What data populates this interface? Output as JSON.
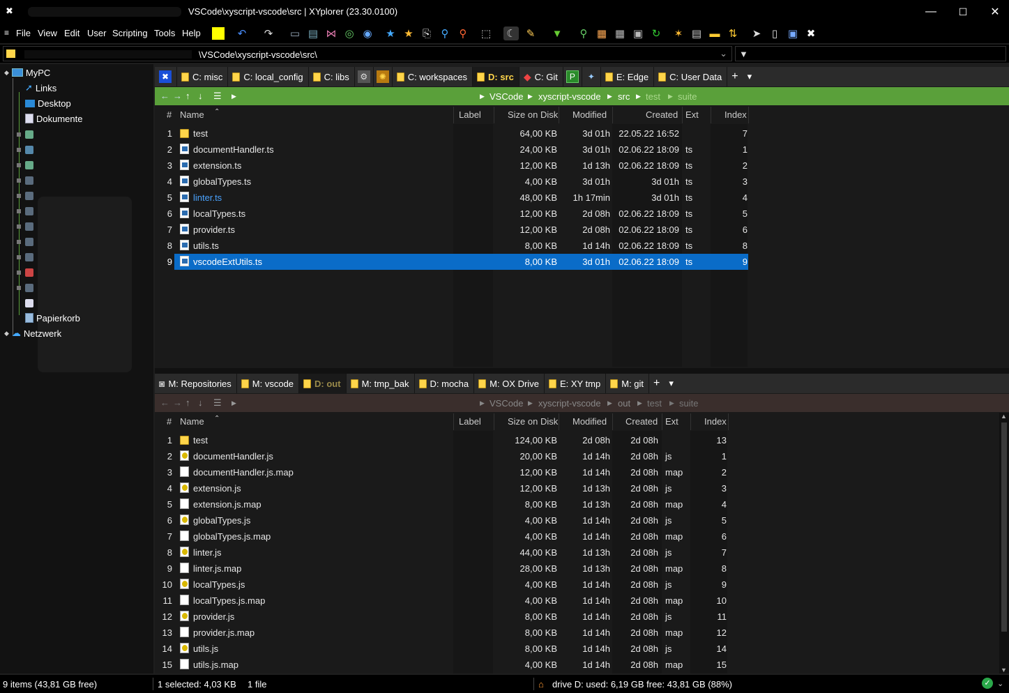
{
  "window": {
    "title": "VSCode\\xyscript-vscode\\src | XYplorer (23.30.0100)",
    "min": "—",
    "max": "☐",
    "close": "✕"
  },
  "menu": [
    "File",
    "View",
    "Edit",
    "User",
    "Scripting",
    "Tools",
    "Help"
  ],
  "address": {
    "value": "\\VSCode\\xyscript-vscode\\src\\"
  },
  "tree": {
    "root": "MyPC",
    "items": [
      "Links",
      "Desktop",
      "Dokumente"
    ],
    "recycle": "Papierkorb",
    "network": "Netzwerk"
  },
  "top_pane": {
    "tabs": [
      {
        "label": "",
        "icon": "xy-icon"
      },
      {
        "label": "C: misc"
      },
      {
        "label": "C: local_config"
      },
      {
        "label": "C: libs"
      },
      {
        "label": "",
        "icon": "gear-icon"
      },
      {
        "label": "",
        "icon": "sun-icon"
      },
      {
        "label": "C: workspaces"
      },
      {
        "label": "D: src",
        "active": true
      },
      {
        "label": "C: Git",
        "icon": "git-icon"
      },
      {
        "label": "",
        "icon": "p-icon"
      },
      {
        "label": "",
        "icon": "tool-icon"
      },
      {
        "label": "E: Edge"
      },
      {
        "label": "C: User Data"
      }
    ],
    "add_tab": "+",
    "tab_menu": "▾",
    "breadcrumb": [
      "VSCode",
      "xyscript-vscode",
      "src",
      "test",
      "suite"
    ],
    "columns": {
      "num": "#",
      "name": "Name",
      "label": "Label",
      "size": "Size on Disk",
      "modified": "Modified",
      "created": "Created",
      "ext": "Ext",
      "index": "Index"
    },
    "rows": [
      {
        "n": "1",
        "name": "test",
        "type": "folder",
        "size": "64,00 KB",
        "modified": "3d 01h",
        "created": "22.05.22  16:52",
        "ext": "",
        "index": "7"
      },
      {
        "n": "2",
        "name": "documentHandler.ts",
        "type": "ts",
        "size": "24,00 KB",
        "modified": "3d 01h",
        "created": "02.06.22  18:09",
        "ext": "ts",
        "index": "1"
      },
      {
        "n": "3",
        "name": "extension.ts",
        "type": "ts",
        "size": "12,00 KB",
        "modified": "1d 13h",
        "created": "02.06.22  18:09",
        "ext": "ts",
        "index": "2"
      },
      {
        "n": "4",
        "name": "globalTypes.ts",
        "type": "ts",
        "size": "4,00 KB",
        "modified": "3d 01h",
        "created": "3d 01h",
        "ext": "ts",
        "index": "3"
      },
      {
        "n": "5",
        "name": "linter.ts",
        "type": "ts",
        "size": "48,00 KB",
        "modified": "1h 17min",
        "created": "3d 01h",
        "ext": "ts",
        "index": "4",
        "highlight": true
      },
      {
        "n": "6",
        "name": "localTypes.ts",
        "type": "ts",
        "size": "12,00 KB",
        "modified": "2d 08h",
        "created": "02.06.22  18:09",
        "ext": "ts",
        "index": "5"
      },
      {
        "n": "7",
        "name": "provider.ts",
        "type": "ts",
        "size": "12,00 KB",
        "modified": "2d 08h",
        "created": "02.06.22  18:09",
        "ext": "ts",
        "index": "6"
      },
      {
        "n": "8",
        "name": "utils.ts",
        "type": "ts",
        "size": "8,00 KB",
        "modified": "1d 14h",
        "created": "02.06.22  18:09",
        "ext": "ts",
        "index": "8"
      },
      {
        "n": "9",
        "name": "vscodeExtUtils.ts",
        "type": "ts",
        "size": "8,00 KB",
        "modified": "3d 01h",
        "created": "02.06.22  18:09",
        "ext": "ts",
        "index": "9",
        "selected": true
      }
    ]
  },
  "bottom_pane": {
    "tabs": [
      {
        "label": "M: Repositories",
        "icon": "camera-icon"
      },
      {
        "label": "M: vscode"
      },
      {
        "label": "D: out",
        "active": true
      },
      {
        "label": "M: tmp_bak"
      },
      {
        "label": "D: mocha"
      },
      {
        "label": "M: OX Drive"
      },
      {
        "label": "E: XY tmp"
      },
      {
        "label": "M: git"
      }
    ],
    "add_tab": "+",
    "tab_menu": "▾",
    "breadcrumb": [
      "VSCode",
      "xyscript-vscode",
      "out",
      "test",
      "suite"
    ],
    "columns": {
      "num": "#",
      "name": "Name",
      "label": "Label",
      "size": "Size on Disk",
      "modified": "Modified",
      "created": "Created",
      "ext": "Ext",
      "index": "Index"
    },
    "rows": [
      {
        "n": "1",
        "name": "test",
        "type": "folder",
        "size": "124,00 KB",
        "modified": "2d 08h",
        "created": "2d 08h",
        "ext": "",
        "index": "13"
      },
      {
        "n": "2",
        "name": "documentHandler.js",
        "type": "js",
        "size": "20,00 KB",
        "modified": "1d 14h",
        "created": "2d 08h",
        "ext": "js",
        "index": "1"
      },
      {
        "n": "3",
        "name": "documentHandler.js.map",
        "type": "map",
        "size": "12,00 KB",
        "modified": "1d 14h",
        "created": "2d 08h",
        "ext": "map",
        "index": "2"
      },
      {
        "n": "4",
        "name": "extension.js",
        "type": "js",
        "size": "12,00 KB",
        "modified": "1d 13h",
        "created": "2d 08h",
        "ext": "js",
        "index": "3"
      },
      {
        "n": "5",
        "name": "extension.js.map",
        "type": "map",
        "size": "8,00 KB",
        "modified": "1d 13h",
        "created": "2d 08h",
        "ext": "map",
        "index": "4"
      },
      {
        "n": "6",
        "name": "globalTypes.js",
        "type": "js",
        "size": "4,00 KB",
        "modified": "1d 14h",
        "created": "2d 08h",
        "ext": "js",
        "index": "5"
      },
      {
        "n": "7",
        "name": "globalTypes.js.map",
        "type": "map",
        "size": "4,00 KB",
        "modified": "1d 14h",
        "created": "2d 08h",
        "ext": "map",
        "index": "6"
      },
      {
        "n": "8",
        "name": "linter.js",
        "type": "js",
        "size": "44,00 KB",
        "modified": "1d 13h",
        "created": "2d 08h",
        "ext": "js",
        "index": "7"
      },
      {
        "n": "9",
        "name": "linter.js.map",
        "type": "map",
        "size": "28,00 KB",
        "modified": "1d 13h",
        "created": "2d 08h",
        "ext": "map",
        "index": "8"
      },
      {
        "n": "10",
        "name": "localTypes.js",
        "type": "js",
        "size": "4,00 KB",
        "modified": "1d 14h",
        "created": "2d 08h",
        "ext": "js",
        "index": "9"
      },
      {
        "n": "11",
        "name": "localTypes.js.map",
        "type": "map",
        "size": "4,00 KB",
        "modified": "1d 14h",
        "created": "2d 08h",
        "ext": "map",
        "index": "10"
      },
      {
        "n": "12",
        "name": "provider.js",
        "type": "js",
        "size": "8,00 KB",
        "modified": "1d 14h",
        "created": "2d 08h",
        "ext": "js",
        "index": "11"
      },
      {
        "n": "13",
        "name": "provider.js.map",
        "type": "map",
        "size": "8,00 KB",
        "modified": "1d 14h",
        "created": "2d 08h",
        "ext": "map",
        "index": "12"
      },
      {
        "n": "14",
        "name": "utils.js",
        "type": "js",
        "size": "8,00 KB",
        "modified": "1d 14h",
        "created": "2d 08h",
        "ext": "js",
        "index": "14"
      },
      {
        "n": "15",
        "name": "utils.js.map",
        "type": "map",
        "size": "4,00 KB",
        "modified": "1d 14h",
        "created": "2d 08h",
        "ext": "map",
        "index": "15"
      }
    ]
  },
  "status": {
    "items": "9 items (43,81 GB free)",
    "selected": "1 selected: 4,03 KB",
    "files": "1 file",
    "drive": "drive D:  used: 6,19 GB   free: 43,81 GB (88%)"
  },
  "colors": {
    "accent_green": "#5aa03a",
    "selection": "#0a6cc8",
    "bottom_crumb": "#3a2e2c",
    "highlight_text": "#4aa3ff"
  }
}
